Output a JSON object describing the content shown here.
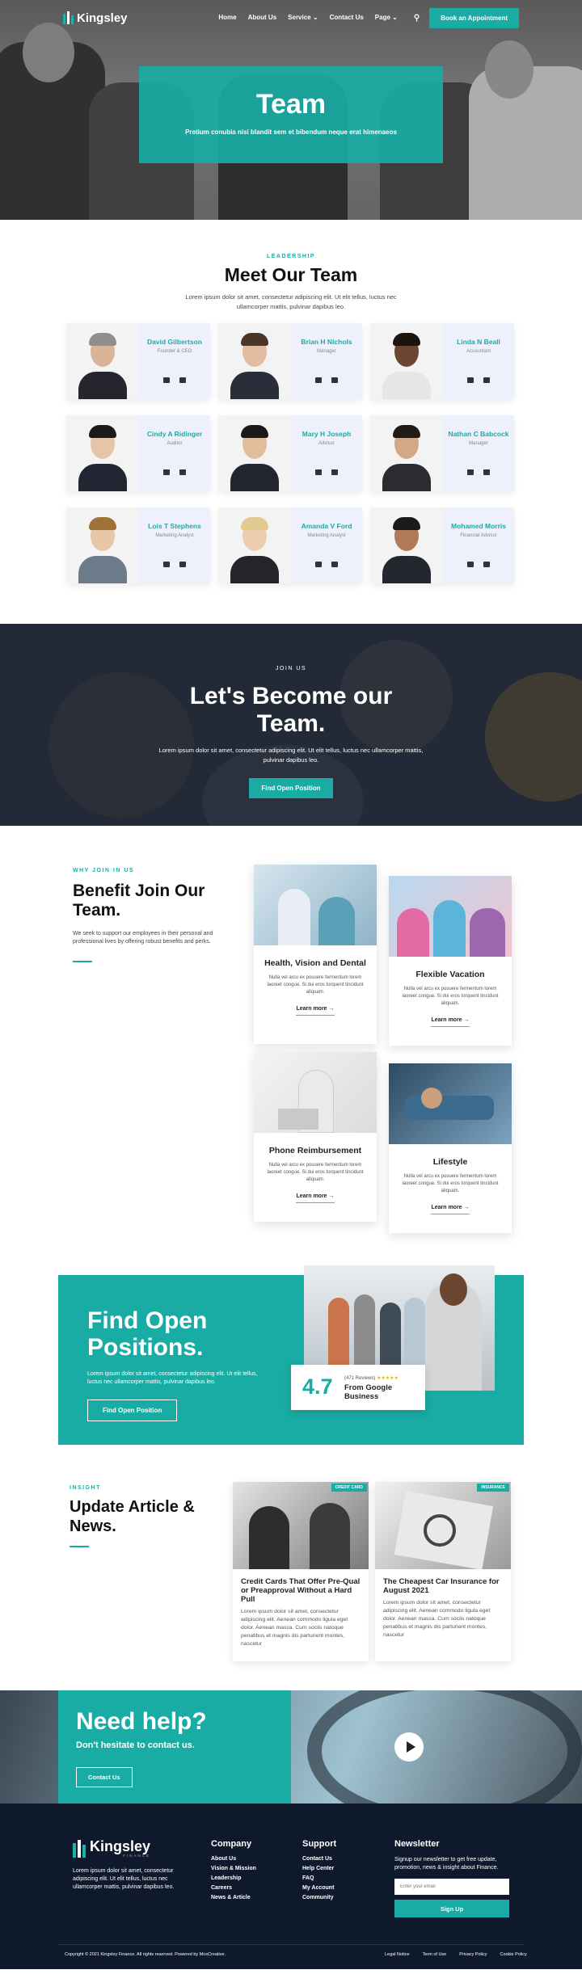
{
  "brand": {
    "name": "Kingsley",
    "footer_sub": "FINANCE"
  },
  "nav": {
    "items": [
      "Home",
      "About Us",
      "Service",
      "Contact Us",
      "Page"
    ],
    "cta": "Book an Appointment"
  },
  "hero": {
    "title": "Team",
    "subtitle": "Pretium conubia nisi blandit sem et bibendum neque erat himenaeos"
  },
  "team": {
    "eyebrow": "LEADERSHIP",
    "title": "Meet Our Team",
    "lead": "Lorem ipsum dolor sit amet, consectetur adipiscing elit. Ut elit tellus, luctus nec ullamcorper mattis, pulvinar dapibus leo.",
    "members": [
      {
        "name": "David Gilbertson",
        "role": "Founder & CEO"
      },
      {
        "name": "Brian H Nichols",
        "role": "Manager"
      },
      {
        "name": "Linda N Beall",
        "role": "Accountant"
      },
      {
        "name": "Cindy A Ridinger",
        "role": "Auditor"
      },
      {
        "name": "Mary H Joseph",
        "role": "Advisor"
      },
      {
        "name": "Nathan C Babcock",
        "role": "Manager"
      },
      {
        "name": "Lois T Stephens",
        "role": "Marketing Analyst"
      },
      {
        "name": "Amanda V Ford",
        "role": "Marketing Analyst"
      },
      {
        "name": "Mohamed Morris",
        "role": "Financial Advisor"
      }
    ]
  },
  "join": {
    "eyebrow": "JOIN US",
    "title_l1": "Let's Become our",
    "title_l2": "Team.",
    "text": "Lorem ipsum dolor sit amet, consectetur adipiscing elit. Ut elit tellus, luctus nec ullamcorper mattis, pulvinar dapibus leo.",
    "cta": "Find Open Position"
  },
  "benefit": {
    "eyebrow": "WHY JOIN IN US",
    "title_l1": "Benefit Join Our",
    "title_l2": "Team.",
    "text": "We seek to support our employees in their personal and professional lives by offering robust benefits and perks.",
    "cards": [
      {
        "title": "Health, Vision and Dental",
        "text": "Nulla vel arcu ex posuere fermentum lorem laoreet congue. Si dui eros torquent tincidunt aliquam.",
        "link": "Learn more →"
      },
      {
        "title": "Flexible Vacation",
        "text": "Nulla vel arcu ex posuere fermentum lorem laoreet congue. Si dui eros torquent tincidunt aliquam.",
        "link": "Learn more →"
      },
      {
        "title": "Phone Reimbursement",
        "text": "Nulla vel arcu ex posuere fermentum lorem laoreet congue. Si dui eros torquent tincidunt aliquam.",
        "link": "Learn more →"
      },
      {
        "title": "Lifestyle",
        "text": "Nulla vel arcu ex posuere fermentum lorem laoreet congue. Si dui eros torquent tincidunt aliquam.",
        "link": "Learn more →"
      }
    ]
  },
  "find": {
    "title_l1": "Find Open",
    "title_l2": "Positions.",
    "text": "Lorem ipsum dolor sit amet, consectetur adipiscing elit. Ut elit tellus, luctus nec ullamcorper mattis, pulvinar dapibus leo.",
    "cta": "Find Open Position",
    "rating": "4.7",
    "reviews": "(471 Reviews)",
    "stars": "★★★★★",
    "rating_source_l1": "From Google",
    "rating_source_l2": "Business"
  },
  "news": {
    "eyebrow": "INSIGHT",
    "title_l1": "Update Article &",
    "title_l2": "News.",
    "articles": [
      {
        "tag": "CREDIT CARD",
        "title": "Credit Cards That Offer Pre-Qual or Preapproval Without a Hard Pull",
        "text": "Lorem ipsum dolor sit amet, consectetur adipiscing elit. Aenean commodo ligula eget dolor. Aenean massa. Cum sociis natoque penatibus et magnis dis parturient montes, nascetur"
      },
      {
        "tag": "INSURANCE",
        "title": "The Cheapest Car Insurance for August 2021",
        "text": "Lorem ipsum dolor sit amet, consectetur adipiscing elit. Aenean commodo ligula eget dolor. Aenean massa. Cum sociis natoque penatibus et magnis dis parturient montes, nascetur"
      }
    ]
  },
  "help": {
    "title": "Need help?",
    "subtitle": "Don't hesitate to contact us.",
    "cta": "Contact Us"
  },
  "footer": {
    "about": "Lorem ipsum dolor sit amet, consectetur adipiscing elit. Ut elit tellus, luctus nec ullamcorper mattis, pulvinar dapibus leo.",
    "company_title": "Company",
    "company": [
      "About Us",
      "Vision & Mission",
      "Leadership",
      "Careers",
      "News & Article"
    ],
    "support_title": "Support",
    "support": [
      "Contact Us",
      "Help Center",
      "FAQ",
      "My Account",
      "Community"
    ],
    "newsletter_title": "Newsletter",
    "newsletter_text": "Signup our newsletter to get free update, promotion, news & insight about Finance.",
    "email_placeholder": "Enter your email",
    "signup": "Sign Up",
    "copyright": "Copyright © 2021 Kingsley Finance. All rights reserved. Powered by MoxCreative.",
    "legal": [
      "Legal Notice",
      "Term of Use",
      "Privacy Policy",
      "Cookie Policy"
    ]
  },
  "colors": {
    "accent": "#19aca4",
    "dark": "#0e1a2b"
  }
}
